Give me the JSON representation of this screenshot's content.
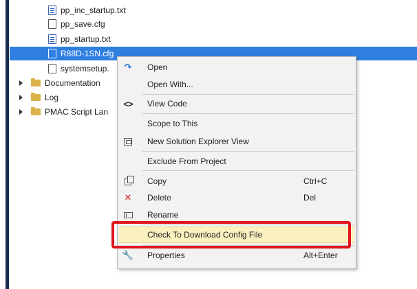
{
  "tree": {
    "items": [
      {
        "label": "pp_inc_startup.txt",
        "type": "txt"
      },
      {
        "label": "pp_save.cfg",
        "type": "file"
      },
      {
        "label": "pp_startup.txt",
        "type": "txt"
      },
      {
        "label": "R88D-1SN.cfg",
        "type": "file",
        "selected": true
      },
      {
        "label": "systemsetup.",
        "type": "file"
      },
      {
        "label": "Documentation",
        "type": "folder"
      },
      {
        "label": "Log",
        "type": "folder"
      },
      {
        "label": "PMAC Script Lan",
        "type": "folder"
      }
    ]
  },
  "context_menu": {
    "open": "Open",
    "open_with": "Open With...",
    "view_code": "View Code",
    "scope_to_this": "Scope to This",
    "new_solution_explorer_view": "New Solution Explorer View",
    "exclude_from_project": "Exclude From Project",
    "copy": "Copy",
    "copy_shortcut": "Ctrl+C",
    "delete": "Delete",
    "delete_shortcut": "Del",
    "rename": "Rename",
    "check_download_config": "Check To Download Config File",
    "properties": "Properties",
    "properties_shortcut": "Alt+Enter"
  },
  "icons": {
    "open": "open-arrow-icon",
    "view_code": "code-brackets-icon",
    "new_solution_explorer_view": "solution-explorer-icon",
    "copy": "copy-icon",
    "delete": "delete-x-icon",
    "rename": "rename-icon",
    "properties": "wrench-icon"
  },
  "colors": {
    "selection": "#2f7fe0",
    "highlight_item": "#fbf0c0",
    "callout_border": "#e0151c",
    "delete_icon": "#d11b1b",
    "open_icon": "#1e6fd6"
  }
}
